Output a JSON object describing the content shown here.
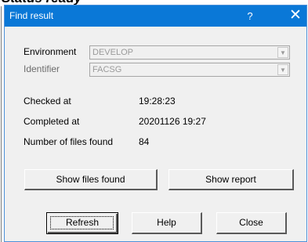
{
  "background": {
    "caption": "Status ready"
  },
  "window": {
    "title": "Find result",
    "help_glyph": "?",
    "close_glyph": "✕",
    "title_color": "#0a78d7"
  },
  "form": {
    "environment": {
      "label": "Environment",
      "value": "DEVELOP",
      "arrow": "▼"
    },
    "identifier": {
      "label": "Identifier",
      "value": "FACSG",
      "arrow": "▼"
    }
  },
  "info": {
    "checked_at": {
      "label": "Checked at",
      "value": "19:28:23"
    },
    "completed_at": {
      "label": "Completed at",
      "value": "20201126 19:27"
    },
    "files_found": {
      "label": "Number of files found",
      "value": "84"
    }
  },
  "buttons": {
    "show_files": "Show files found",
    "show_report": "Show report",
    "refresh": "Refresh",
    "help": "Help",
    "close": "Close"
  }
}
